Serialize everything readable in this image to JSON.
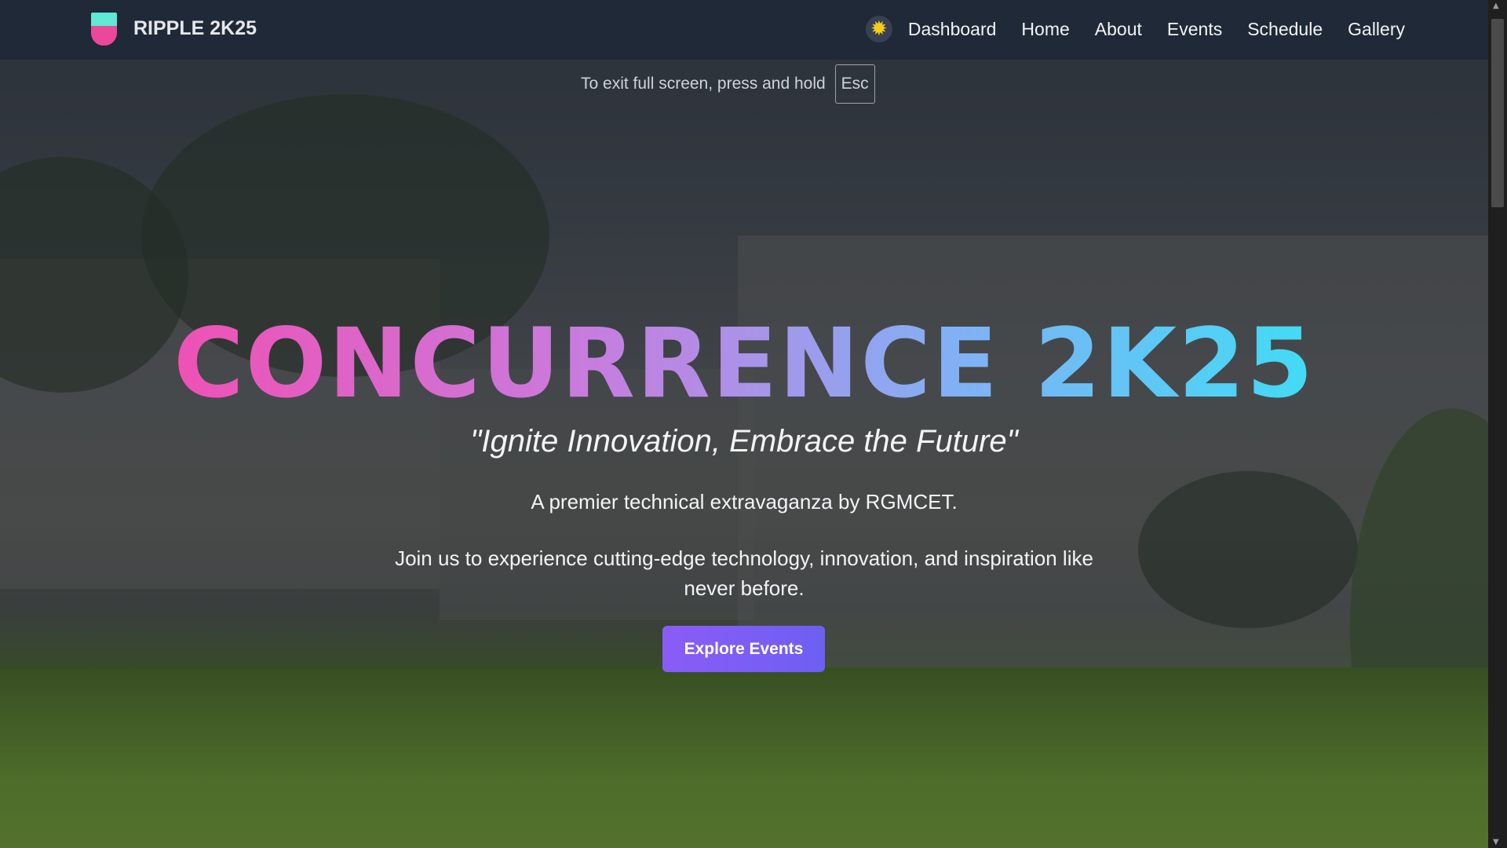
{
  "nav": {
    "brand": "RIPPLE 2K25",
    "theme_icon": "sun-icon",
    "links": [
      "Dashboard",
      "Home",
      "About",
      "Events",
      "Schedule",
      "Gallery"
    ]
  },
  "fullscreen_notice": {
    "text": "To exit full screen, press and hold",
    "key": "Esc"
  },
  "hero": {
    "title": "CONCURRENCE 2K25",
    "tagline": "\"Ignite Innovation, Embrace the Future\"",
    "subtitle": "A premier technical extravaganza by RGMCET.",
    "description": "Join us to experience cutting-edge technology, innovation, and inspiration like never before.",
    "cta": "Explore Events"
  },
  "colors": {
    "nav_bg": "#1f2937",
    "button": "#8b5cf6",
    "title_gradient": [
      "#ff3fa4",
      "#c77ddf",
      "#7fb2f5",
      "#22f0f5"
    ]
  }
}
